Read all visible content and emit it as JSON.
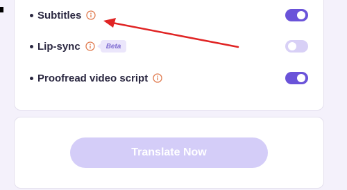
{
  "settings": {
    "items": [
      {
        "label": "Subtitles",
        "icon": "info-icon",
        "toggle_state": "on"
      },
      {
        "label": "Lip-sync",
        "icon": "info-icon",
        "badge": "Beta",
        "toggle_state": "off-disabled"
      },
      {
        "label": "Proofread video script",
        "icon": "info-icon",
        "toggle_state": "on"
      }
    ]
  },
  "action": {
    "translate_label": "Translate Now"
  },
  "colors": {
    "accent": "#6a53d9",
    "accent_disabled": "#d4cdf8",
    "info_icon": "#e07b4f",
    "annotation_arrow": "#e02424",
    "text": "#2a2740"
  }
}
